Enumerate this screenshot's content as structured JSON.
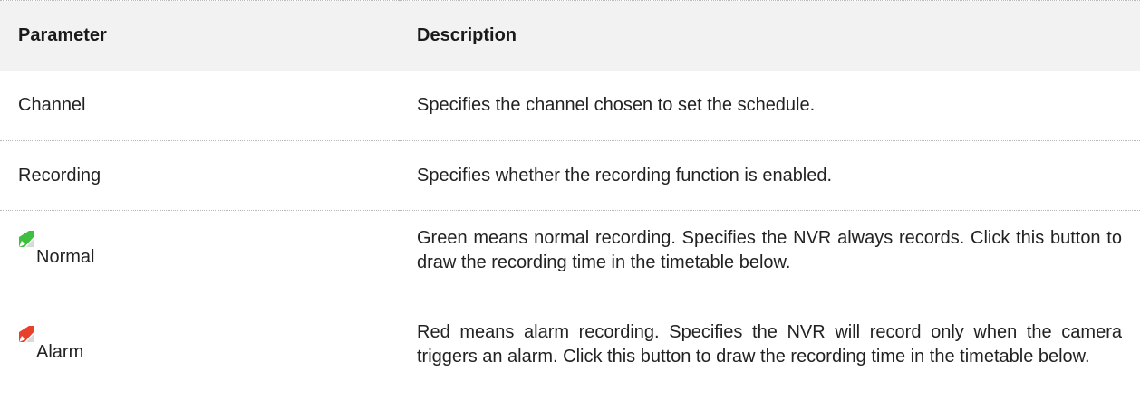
{
  "table": {
    "headers": {
      "parameter": "Parameter",
      "description": "Description"
    },
    "rows": [
      {
        "parameter": "Channel",
        "description": "Specifies the channel chosen to set the schedule."
      },
      {
        "parameter": "Recording",
        "description": "Specifies whether the recording function is enabled."
      },
      {
        "parameter": "Normal",
        "icon": "green-pen-icon",
        "icon_color": "#3fbf3f",
        "description": "Green means normal recording. Specifies the NVR always records. Click this button to draw the recording time in the timetable below."
      },
      {
        "parameter": "Alarm",
        "icon": "red-pen-icon",
        "icon_color": "#e8402a",
        "description": "Red means alarm recording. Specifies the NVR will record only when the camera triggers an alarm. Click this button to draw the recording time in the timetable below."
      }
    ]
  }
}
